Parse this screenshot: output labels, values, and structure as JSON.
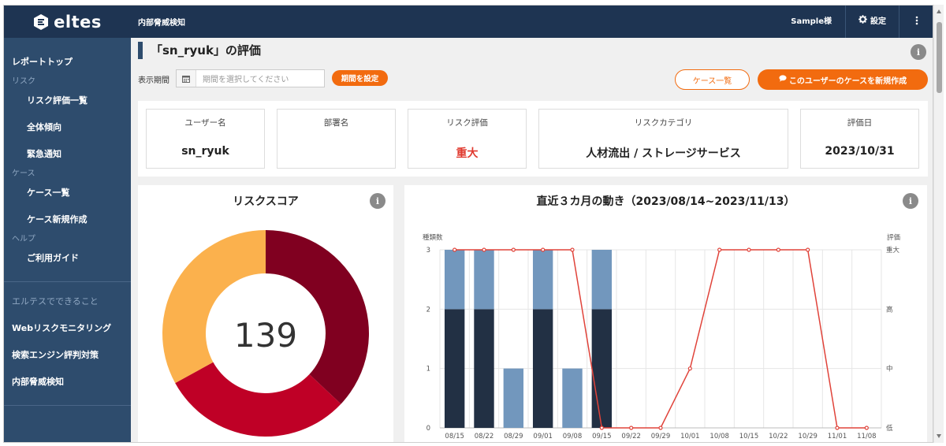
{
  "brand": {
    "name": "eltes"
  },
  "sidebar": {
    "items": [
      {
        "type": "item",
        "label": "レポートトップ"
      },
      {
        "type": "section",
        "label": "リスク"
      },
      {
        "type": "sub",
        "label": "リスク評価一覧"
      },
      {
        "type": "sub",
        "label": "全体傾向"
      },
      {
        "type": "sub",
        "label": "緊急通知"
      },
      {
        "type": "section",
        "label": "ケース"
      },
      {
        "type": "sub",
        "label": "ケース一覧"
      },
      {
        "type": "sub",
        "label": "ケース新規作成"
      },
      {
        "type": "section",
        "label": "ヘルプ"
      },
      {
        "type": "sub",
        "label": "ご利用ガイド"
      }
    ],
    "extra_title": "エルテスでできること",
    "extra_items": [
      "Webリスクモニタリング",
      "検索エンジン評判対策",
      "内部脅威検知"
    ]
  },
  "topbar": {
    "title": "内部脅威検知",
    "user": "Sample様",
    "settings_label": "設定",
    "settings_icon": "gear-icon",
    "more_icon": "kebab-icon"
  },
  "page": {
    "title": "「sn_ryuk」の評価",
    "period_label": "表示期間",
    "period_placeholder": "期間を選択してください",
    "period_button": "期間を設定",
    "case_list_button": "ケース一覧",
    "new_case_button": "このユーザーのケースを新規作成"
  },
  "summary": [
    {
      "label": "ユーザー名",
      "value": "sn_ryuk"
    },
    {
      "label": "部署名",
      "value": ""
    },
    {
      "label": "リスク評価",
      "value": "重大"
    },
    {
      "label": "リスクカテゴリ",
      "value": "人材流出 / ストレージサービス"
    },
    {
      "label": "評価日",
      "value": "2023/10/31"
    }
  ],
  "risk_score": {
    "title": "リスクスコア",
    "value": "139"
  },
  "colors": {
    "accent": "#f26b0f",
    "sidebar": "#2e4c6d",
    "topbar": "#1e3452",
    "critical_red": "#e03a2f",
    "donut": [
      "#800020",
      "#bf0026",
      "#fbb14d"
    ],
    "bar_dark": "#223044",
    "bar_light": "#7297bd",
    "line": "#e0433a"
  },
  "chart_data": [
    {
      "type": "pie",
      "title": "リスクスコア",
      "center_label": "139",
      "slices": [
        {
          "value": 0.37,
          "color": "#800020"
        },
        {
          "value": 0.3,
          "color": "#bf0026"
        },
        {
          "value": 0.33,
          "color": "#fbb14d"
        }
      ]
    },
    {
      "type": "bar",
      "title": "直近３カ月の動き（2023/08/14~2023/11/13）",
      "categories": [
        "08/15",
        "08/22",
        "08/29",
        "09/01",
        "09/08",
        "09/15",
        "09/22",
        "09/29",
        "10/01",
        "10/08",
        "10/15",
        "10/22",
        "10/29",
        "11/01",
        "11/08"
      ],
      "ylabel": "種類数",
      "y2label": "評価",
      "ylim": [
        0,
        3
      ],
      "yticks": [
        "0",
        "1",
        "2",
        "3"
      ],
      "y2ticks": [
        "低",
        "中",
        "高",
        "重大"
      ],
      "grid": true,
      "series": [
        {
          "values": [
            2,
            2,
            0,
            2,
            0,
            2,
            0,
            0,
            0,
            0,
            0,
            0,
            0,
            0,
            0
          ],
          "color": "#223044",
          "stack": "a"
        },
        {
          "values": [
            1,
            1,
            1,
            1,
            1,
            1,
            0,
            0,
            0,
            0,
            0,
            0,
            0,
            0,
            0
          ],
          "color": "#7297bd",
          "stack": "a"
        },
        {
          "type": "line",
          "axis": "right",
          "values": [
            3,
            3,
            3,
            3,
            3,
            0,
            0,
            0,
            1,
            3,
            3,
            3,
            3,
            0,
            0
          ],
          "color": "#e0433a"
        }
      ]
    }
  ]
}
